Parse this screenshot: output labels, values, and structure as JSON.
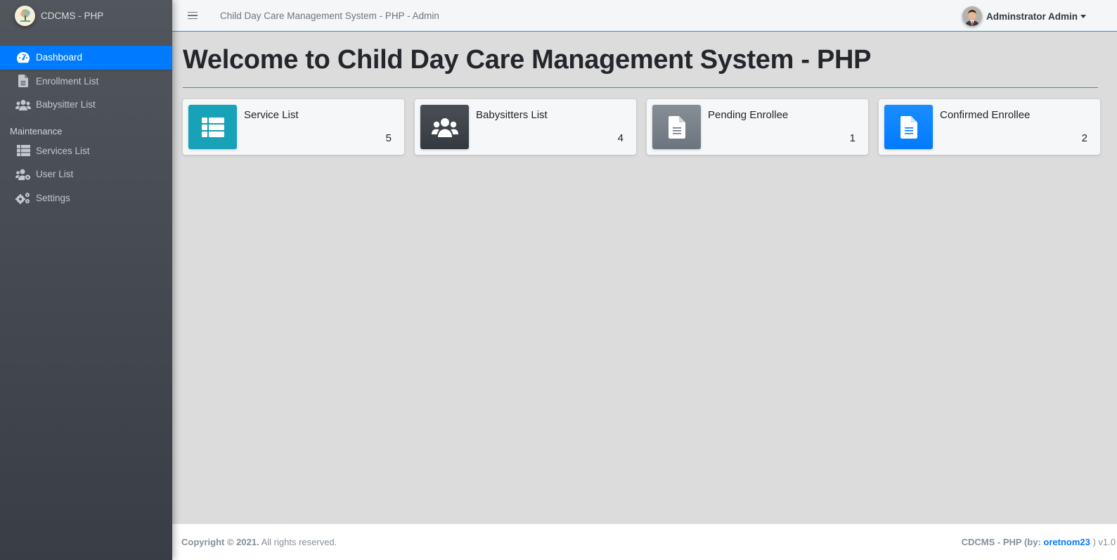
{
  "brand": {
    "name": "CDCMS - PHP",
    "logo_icon": "tree-logo-icon"
  },
  "sidebar": {
    "items": [
      {
        "label": "Dashboard",
        "icon": "tachometer-icon",
        "active": true
      },
      {
        "label": "Enrollment List",
        "icon": "file-icon",
        "active": false
      },
      {
        "label": "Babysitter List",
        "icon": "users-icon",
        "active": false
      }
    ],
    "section_header": "Maintenance",
    "maintenance_items": [
      {
        "label": "Services List",
        "icon": "table-list-icon"
      },
      {
        "label": "User List",
        "icon": "users-cog-icon"
      },
      {
        "label": "Settings",
        "icon": "cogs-icon"
      }
    ]
  },
  "topbar": {
    "menu_icon": "hamburger-icon",
    "title": "Child Day Care Management System - PHP - Admin",
    "user_name": "Adminstrator Admin"
  },
  "main": {
    "page_title": "Welcome to Child Day Care Management System - PHP",
    "cards": [
      {
        "label": "Service List",
        "value": "5",
        "icon": "table-list-icon",
        "color": "#17a2b8"
      },
      {
        "label": "Babysitters List",
        "value": "4",
        "icon": "users-icon",
        "color": "#343a40"
      },
      {
        "label": "Pending Enrollee",
        "value": "1",
        "icon": "file-alt-icon",
        "color": "#6c757d"
      },
      {
        "label": "Confirmed Enrollee",
        "value": "2",
        "icon": "file-alt-icon",
        "color": "#007bff"
      }
    ]
  },
  "footer": {
    "copyright_bold": "Copyright © 2021.",
    "copyright_rest": " All rights reserved.",
    "credit_prefix": "CDCMS - PHP (by: ",
    "credit_link": "oretnom23",
    "credit_suffix": " ) v1.0"
  }
}
